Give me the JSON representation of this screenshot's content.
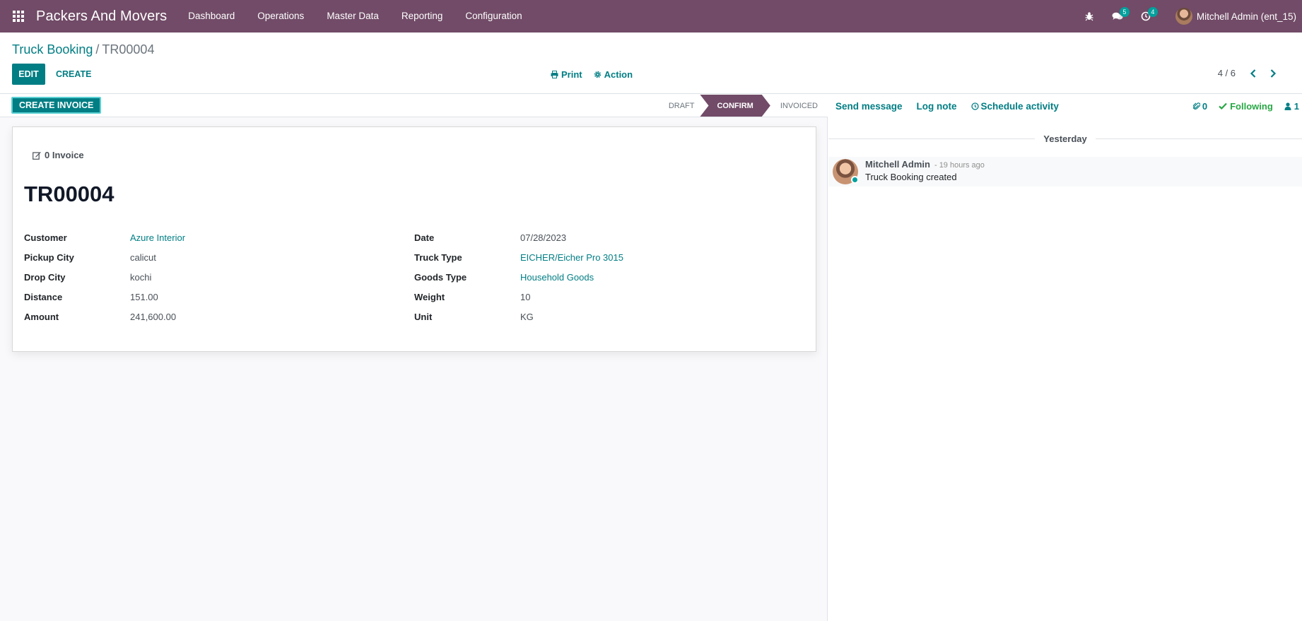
{
  "app": {
    "brand": "Packers And Movers",
    "menu": [
      "Dashboard",
      "Operations",
      "Master Data",
      "Reporting",
      "Configuration"
    ],
    "messages_badge": "5",
    "activities_badge": "4",
    "user_name": "Mitchell Admin (ent_15)"
  },
  "breadcrumb": {
    "parent": "Truck Booking",
    "separator": "/",
    "current": "TR00004"
  },
  "buttons": {
    "edit": "EDIT",
    "create": "CREATE",
    "print": "Print",
    "action": "Action",
    "create_invoice": "CREATE INVOICE"
  },
  "pager": {
    "value": "4 / 6"
  },
  "stages": [
    "DRAFT",
    "CONFIRM",
    "INVOICED"
  ],
  "active_stage": "CONFIRM",
  "smart_button": {
    "count": "0",
    "label": "Invoice"
  },
  "record": {
    "title": "TR00004",
    "left_fields": [
      {
        "label": "Customer",
        "value": "Azure Interior"
      },
      {
        "label": "Pickup City",
        "value": "calicut"
      },
      {
        "label": "Drop City",
        "value": "kochi"
      },
      {
        "label": "Distance",
        "value": "151.00"
      },
      {
        "label": "Amount",
        "value": "241,600.00"
      }
    ],
    "right_fields": [
      {
        "label": "Date",
        "value": "07/28/2023"
      },
      {
        "label": "Truck Type",
        "value": "EICHER/Eicher Pro 3015"
      },
      {
        "label": "Goods Type",
        "value": "Household Goods"
      },
      {
        "label": "Weight",
        "value": "10"
      },
      {
        "label": "Unit",
        "value": "KG"
      }
    ]
  },
  "chatter": {
    "send_message": "Send message",
    "log_note": "Log note",
    "schedule_activity": "Schedule activity",
    "attachments": "0",
    "following": "Following",
    "followers": "1",
    "date_separator": "Yesterday",
    "messages": [
      {
        "author": "Mitchell Admin",
        "time": "- 19 hours ago",
        "text": "Truck Booking created"
      }
    ]
  },
  "colors": {
    "navbar": "#714B67",
    "primary": "#017e84",
    "success": "#28a745"
  }
}
